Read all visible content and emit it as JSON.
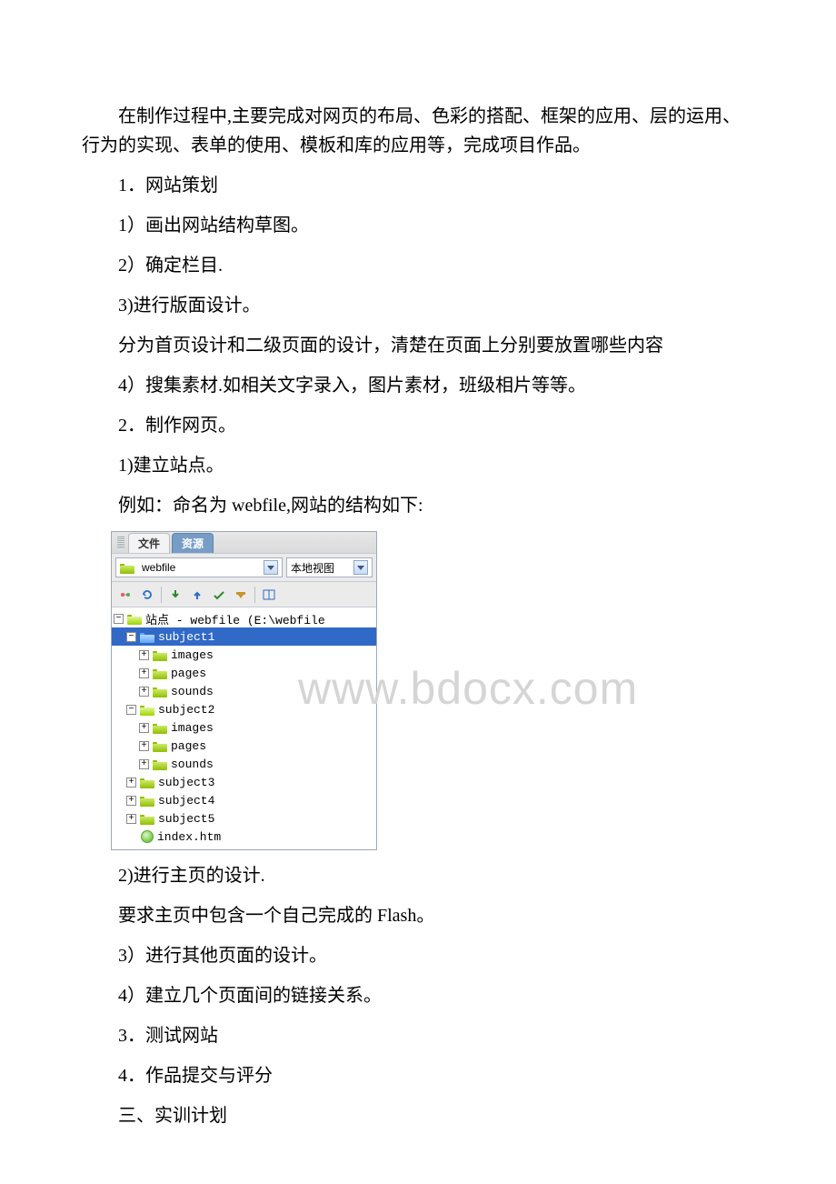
{
  "paragraphs": {
    "intro": "在制作过程中,主要完成对网页的布局、色彩的搭配、框架的应用、层的运用、行为的实现、表单的使用、模板和库的应用等，完成项目作品。",
    "p1": "1．网站策划",
    "p1_1": "1）画出网站结构草图。",
    "p1_2": "2）确定栏目.",
    "p1_3": "3)进行版面设计。",
    "p1_3a": "分为首页设计和二级页面的设计，清楚在页面上分别要放置哪些内容",
    "p1_4": "4）搜集素材.如相关文字录入，图片素材，班级相片等等。",
    "p2": "2．制作网页。",
    "p2_1": "1)建立站点。",
    "p2_1a": "例如：命名为 webfile,网站的结构如下:",
    "p2_2": "2)进行主页的设计.",
    "p2_2a": "要求主页中包含一个自己完成的 Flash。",
    "p2_3": "3）进行其他页面的设计。",
    "p2_4": "4）建立几个页面间的链接关系。",
    "p3": "3．测试网站",
    "p4": "4．作品提交与评分",
    "s3": "三、实训计划"
  },
  "panel": {
    "tabs": {
      "active": "文件",
      "inactive": "资源"
    },
    "siteSelect": "webfile",
    "viewSelect": "本地视图",
    "watermark": "www.bdocx.com",
    "tree": {
      "root": "站点 - webfile (E:\\webfile",
      "subjects": [
        {
          "name": "subject1",
          "expanded": true,
          "selected": true,
          "children": [
            "images",
            "pages",
            "sounds"
          ]
        },
        {
          "name": "subject2",
          "expanded": true,
          "selected": false,
          "children": [
            "images",
            "pages",
            "sounds"
          ]
        },
        {
          "name": "subject3",
          "expanded": false
        },
        {
          "name": "subject4",
          "expanded": false
        },
        {
          "name": "subject5",
          "expanded": false
        }
      ],
      "indexFile": "index.htm"
    }
  }
}
